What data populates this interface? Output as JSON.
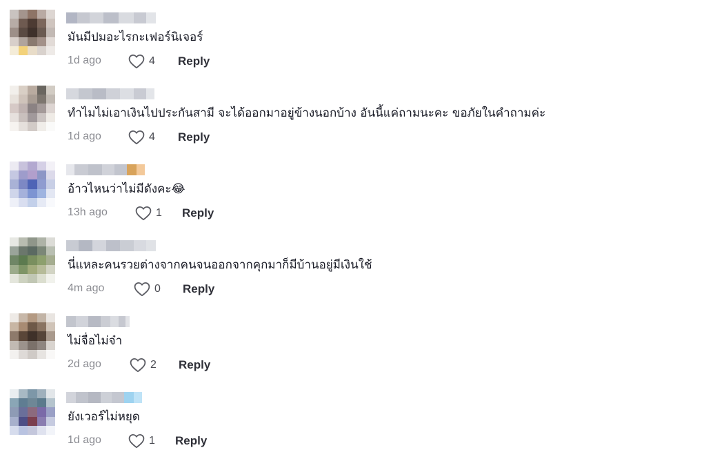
{
  "comments": [
    {
      "text": "มันมีปมอะไรกะเฟอร์นิเจอร์",
      "time": "1d ago",
      "likes": "4",
      "reply_label": "Reply",
      "avatar_colors": [
        "#c9c3c0",
        "#a4958d",
        "#8e7466",
        "#b9aaa3",
        "#ddd6d2",
        "#b7aca6",
        "#6e5a50",
        "#4d3b33",
        "#7c675c",
        "#cfc5bf",
        "#9d8f88",
        "#5a4a42",
        "#3f312b",
        "#6a5a51",
        "#c2b9b4",
        "#d8cfca",
        "#b0a49d",
        "#8a7a70",
        "#a39189",
        "#e2dbd7",
        "#f4ecd8",
        "#f3d27a",
        "#e8dcc8",
        "#d9d2cd",
        "#eeeae7"
      ],
      "name_colors": [
        "#b2b6c4",
        "#c6c8d0",
        "#d2d4da",
        "#bcbfc9",
        "#d9dbe0",
        "#c8cad2",
        "#e2e4e8"
      ]
    },
    {
      "text": "ทำไมไม่เอาเงินไปประกันสามี จะได้ออกมาอยู่ข้างนอกบ้าง อันนี้แค่ถามนะคะ ขอภัยในคำถามค่ะ",
      "time": "1d ago",
      "likes": "4",
      "reply_label": "Reply",
      "avatar_colors": [
        "#f2efeb",
        "#d9cfc5",
        "#b9aba0",
        "#6a6660",
        "#d2ccc4",
        "#e8e2dc",
        "#cfc3ba",
        "#a89c93",
        "#7d766f",
        "#c1bab3",
        "#d6c9c6",
        "#bfb2b0",
        "#8b8283",
        "#a49a99",
        "#ddd5d2",
        "#e6e0dd",
        "#c9c0bd",
        "#a1999b",
        "#cbc4c2",
        "#efebe6",
        "#f6f3f0",
        "#e5e0dc",
        "#d2cbc7",
        "#f0ede9",
        "#fafaf9"
      ],
      "name_colors": [
        "#d6d8de",
        "#c4c7cf",
        "#b9bcc6",
        "#cfd1d8",
        "#dcdee3",
        "#c9cbd3",
        "#e3e5e9"
      ]
    },
    {
      "text": "อ้าวไหนว่าไม่มีดังคะ😂",
      "time": "13h ago",
      "likes": "1",
      "reply_label": "Reply",
      "avatar_colors": [
        "#eceaf2",
        "#c8c2dc",
        "#b3a9d0",
        "#d5d0e6",
        "#f3f1f7",
        "#c5c8e2",
        "#9e9ccb",
        "#b29fcc",
        "#8d96c6",
        "#dcdaea",
        "#a9b2d6",
        "#7d88c4",
        "#4f64b6",
        "#8f9cd0",
        "#c8cfe6",
        "#cfd5ea",
        "#a5b1db",
        "#7d94d2",
        "#9fb4e0",
        "#e3e7f3",
        "#eef0f8",
        "#d9def0",
        "#c3d0ea",
        "#e6eaf5",
        "#f8f9fc"
      ],
      "name_colors": [
        "#e6e7ec",
        "#c9cbd3",
        "#bfc2cb",
        "#d0d2d9",
        "#c2c5ce",
        "#d8a35b",
        "#f3c99a"
      ]
    },
    {
      "text": "นี่แหละคนรวยต่างจากคนจนออกจากคุกมาก็มีบ้านอยู่มีเงินใช้",
      "time": "4m ago",
      "likes": "0",
      "reply_label": "Reply",
      "avatar_colors": [
        "#e7e8e3",
        "#b8bcb0",
        "#8f968a",
        "#aeb3a7",
        "#dcdcd7",
        "#9aa49a",
        "#6b776c",
        "#5b6a62",
        "#7b8778",
        "#b9bfb2",
        "#6f8666",
        "#5c7a4f",
        "#7a8f5f",
        "#8da06e",
        "#a5ad90",
        "#9cab8b",
        "#7e9466",
        "#a2ab7c",
        "#b6bb99",
        "#d2d4c4",
        "#e4e6dc",
        "#cdd2c0",
        "#c1c7b4",
        "#dbdecf",
        "#f1f2ec"
      ],
      "name_colors": [
        "#c8cbd3",
        "#b4b8c3",
        "#d3d5dc",
        "#bdc0ca",
        "#cacdd4",
        "#d8dae0",
        "#e0e2e6"
      ]
    },
    {
      "text": "ไม่จื่อไม่จ๋า",
      "time": "2d ago",
      "likes": "2",
      "reply_label": "Reply",
      "avatar_colors": [
        "#eeeae6",
        "#c7b7a8",
        "#b49a83",
        "#c2b4a6",
        "#e9e5e1",
        "#c8b6a4",
        "#a88b73",
        "#6e5948",
        "#8a7462",
        "#d0c4b8",
        "#8e7a6b",
        "#5a4638",
        "#3f3129",
        "#564539",
        "#a99a8d",
        "#c2bab3",
        "#9c938c",
        "#7b716a",
        "#8f8680",
        "#d9d4cf",
        "#f3f1ef",
        "#dedad7",
        "#cfcac6",
        "#e7e4e1",
        "#f9f8f7"
      ],
      "name_colors": [
        "#c2c5cd",
        "#d1d3da",
        "#b7bac4",
        "#cbcdd4",
        "#dadce1",
        "#c6c8d0",
        "#e2e3e7"
      ]
    },
    {
      "text": "ยังเวอร์ไม่หยุด",
      "time": "1d ago",
      "likes": "1",
      "reply_label": "Reply",
      "avatar_colors": [
        "#e9edf0",
        "#a8b9c4",
        "#7d97a8",
        "#9fb0bc",
        "#e2e6e9",
        "#8aa6b6",
        "#5f7d92",
        "#6e8796",
        "#5b7a8c",
        "#b5c4cd",
        "#8e9bb5",
        "#6a6f9a",
        "#8c6a7e",
        "#7a6aa8",
        "#9aa0c6",
        "#a7b0cc",
        "#4d4e86",
        "#7b3f4f",
        "#8a7db0",
        "#c6cbe0",
        "#d6dced",
        "#b9c3e1",
        "#c4c7dc",
        "#dfe2ef",
        "#f2f4f9"
      ],
      "name_colors": [
        "#d2d4db",
        "#c0c3cc",
        "#b5b8c2",
        "#cdd0d7",
        "#c4c7d0",
        "#9ed3f0",
        "#bfe3f7"
      ]
    }
  ]
}
